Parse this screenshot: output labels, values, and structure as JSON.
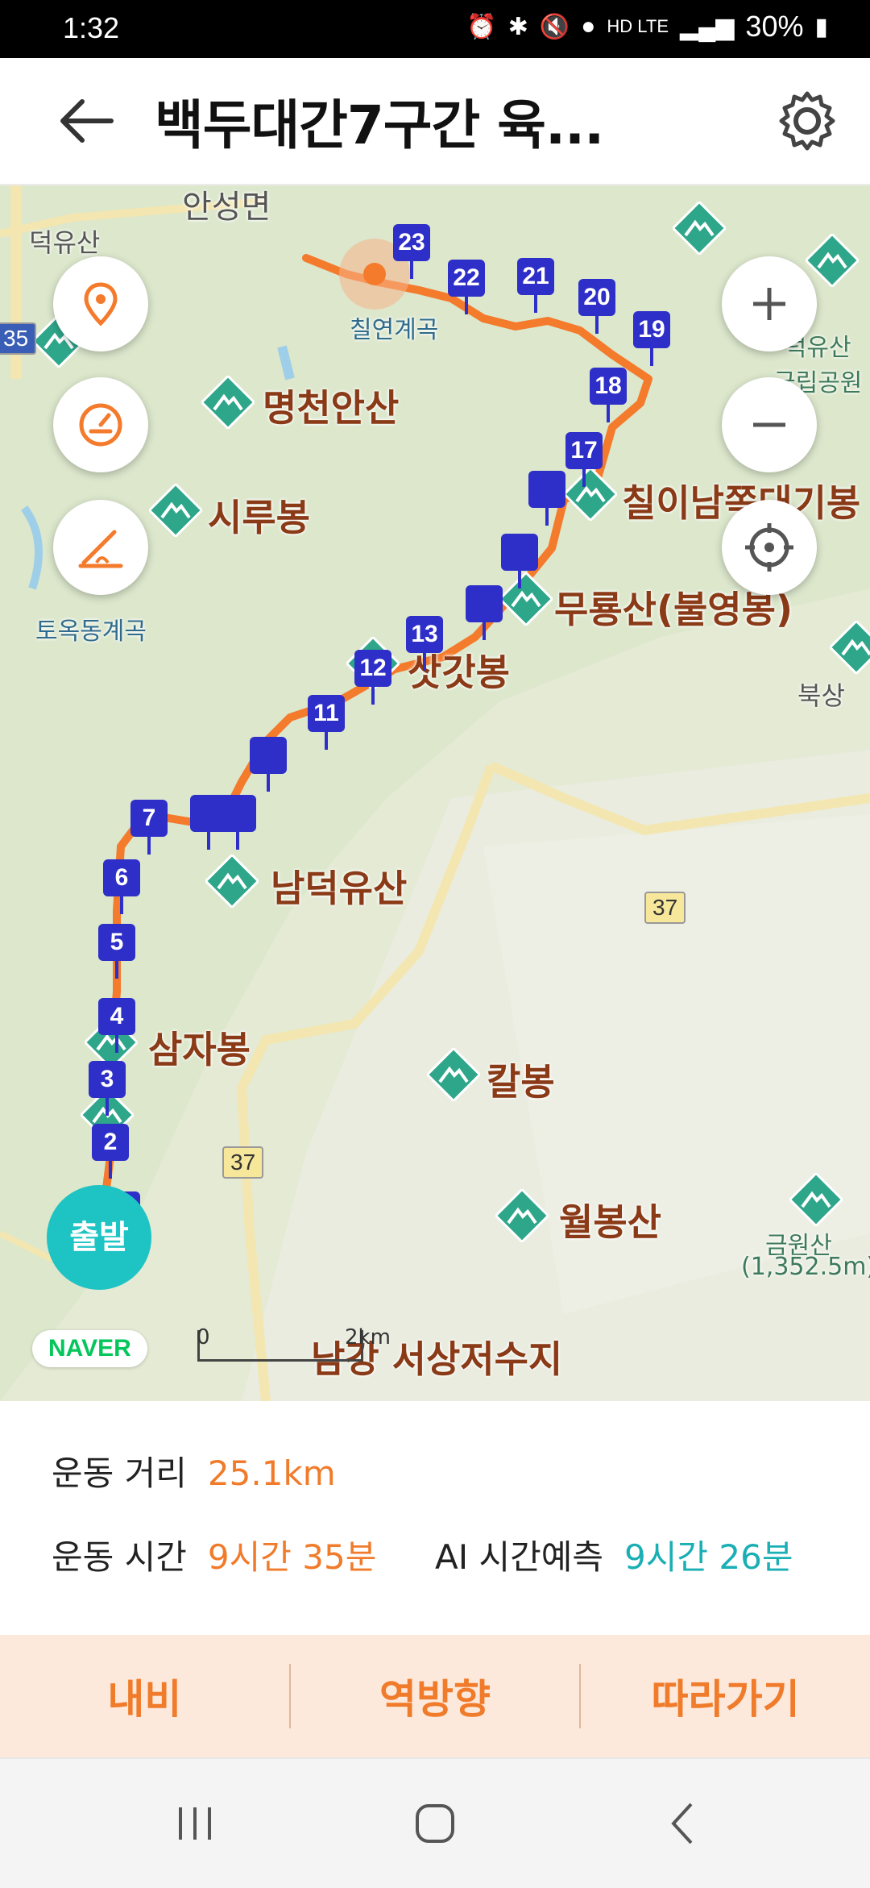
{
  "status_bar": {
    "time": "1:32",
    "network": "HD LTE",
    "battery": "30%"
  },
  "header": {
    "title": "백두대간7구간 육..."
  },
  "map": {
    "labels": {
      "deogyusan": "덕유산",
      "anseong": "안성면",
      "chilyeon": "칠연계곡",
      "myeongcheon": "명천안산",
      "sirubong": "시루봉",
      "tookdong": "토옥동계곡",
      "chilinam": "칠이남쪽대기봉",
      "muryong": "무룡산(불영봉)",
      "satgat": "삿갓봉",
      "namdeogyu": "남덕유산",
      "samja": "삼자봉",
      "kalbong": "칼봉",
      "wolbong": "월봉산",
      "geumwon": "금원산",
      "geumwon_elev": "(1,352.5m)",
      "namgang": "남강 서상저수지",
      "buksang": "북상",
      "park": "덕유산\n국립공원"
    },
    "road_numbers": [
      "37",
      "37",
      "35"
    ],
    "waypoints": [
      "1",
      "2",
      "3",
      "4",
      "5",
      "6",
      "7",
      "11",
      "12",
      "13",
      "17",
      "18",
      "19",
      "20",
      "21",
      "22",
      "23"
    ],
    "start_label": "출발",
    "naver_logo": "NAVER",
    "scale": {
      "zero": "0",
      "distance": "2km"
    },
    "route_color": "#f47a2c",
    "waypoint_color": "#2e2ec8"
  },
  "stats": {
    "distance_label": "운동 거리",
    "distance_value": "25.1km",
    "time_label": "운동 시간",
    "time_value": "9시간 35분",
    "ai_label": "AI 시간예측",
    "ai_value": "9시간 26분"
  },
  "actions": {
    "navi": "내비",
    "reverse": "역방향",
    "follow": "따라가기"
  }
}
